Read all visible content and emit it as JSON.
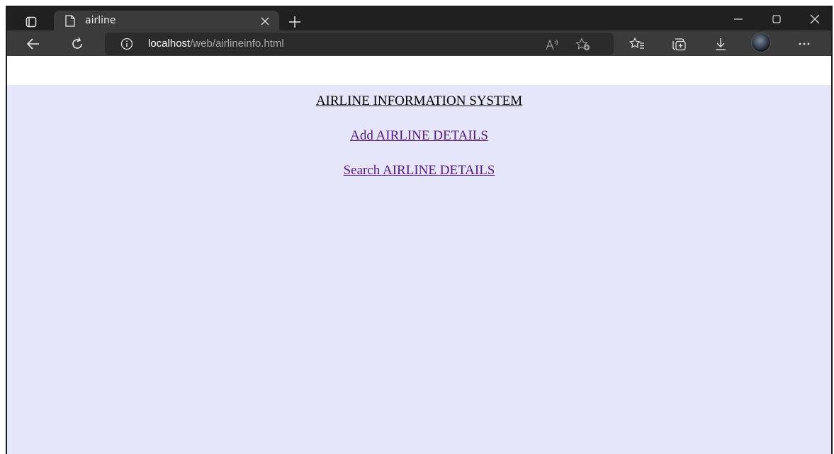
{
  "browser": {
    "tab_title": "airline",
    "url_host": "localhost",
    "url_path": "/web/airlineinfo.html",
    "icons": [
      "tab-actions-icon",
      "page-icon",
      "close-icon",
      "plus-icon",
      "minimize-icon",
      "maximize-icon",
      "close-window-icon",
      "back-icon",
      "refresh-icon",
      "info-icon",
      "read-aloud-icon",
      "add-favorite-icon",
      "favorites-icon",
      "collections-icon",
      "download-icon",
      "profile-avatar",
      "more-icon"
    ],
    "colors": {
      "chrome_dark": "#202020",
      "chrome_tab": "#3b3b3b",
      "address_bar": "#2b2b2b"
    }
  },
  "page": {
    "background": "#e6e6fa",
    "heading": "AIRLINE INFORMATION SYSTEM",
    "links": {
      "add": "Add AIRLINE DETAILS",
      "search": "Search AIRLINE DETAILS"
    },
    "link_color": "#551a8b"
  }
}
